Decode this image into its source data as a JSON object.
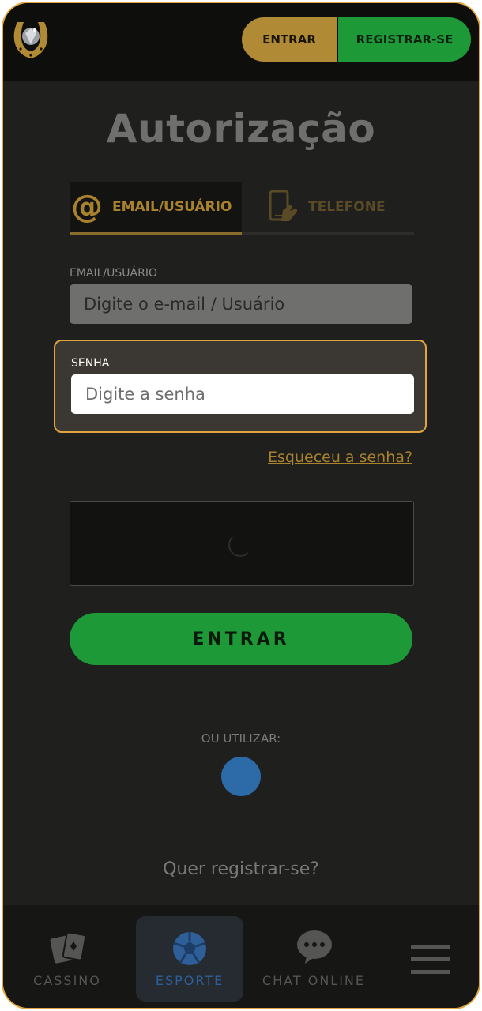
{
  "header": {
    "entrar_label": "ENTRAR",
    "registrar_label": "REGISTRAR-SE"
  },
  "page": {
    "title": "Autorização"
  },
  "tabs": [
    {
      "label": "EMAIL/USUÁRIO",
      "icon": "at-sign-icon",
      "active": true
    },
    {
      "label": "TELEFONE",
      "icon": "phone-icon",
      "active": false
    }
  ],
  "form": {
    "email_label": "EMAIL/USUÁRIO",
    "email_placeholder": "Digite o e-mail / Usuário",
    "senha_label": "SENHA",
    "senha_placeholder": "Digite a senha",
    "forgot_label": "Esqueceu a senha?",
    "submit_label": "ENTRAR"
  },
  "social": {
    "divider_label": "OU UTILIZAR:"
  },
  "register_prompt": "Quer registrar-se?",
  "bottom_nav": [
    {
      "label": "CASSINO",
      "icon": "cards-icon",
      "active": false
    },
    {
      "label": "ESPORTE",
      "icon": "soccer-ball-icon",
      "active": true
    },
    {
      "label": "CHAT ONLINE",
      "icon": "chat-bubble-icon",
      "active": false
    },
    {
      "label": "",
      "icon": "hamburger-menu-icon",
      "active": false
    }
  ],
  "colors": {
    "accent": "#e1a43f",
    "gold": "#b08a34",
    "green": "#1e9938",
    "background": "#1f1f1e",
    "header": "#0e0e0d",
    "esporte_blue": "#2f5f98"
  }
}
